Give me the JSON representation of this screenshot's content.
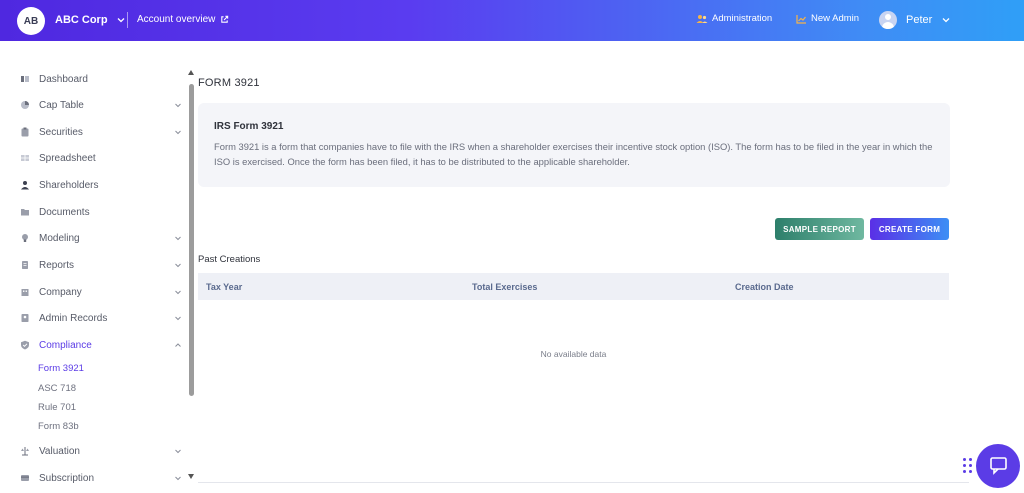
{
  "topbar": {
    "avatar_initials": "AB",
    "company_name": "ABC Corp",
    "account_link": "Account overview",
    "administration": "Administration",
    "new_admin": "New Admin",
    "user_name": "Peter"
  },
  "sidebar": {
    "items": [
      {
        "label": "Dashboard",
        "icon": "dashboard-icon",
        "has_arrow": false
      },
      {
        "label": "Cap Table",
        "icon": "pie-chart-icon",
        "has_arrow": true
      },
      {
        "label": "Securities",
        "icon": "clipboard-icon",
        "has_arrow": true
      },
      {
        "label": "Spreadsheet",
        "icon": "grid-icon",
        "has_arrow": false
      },
      {
        "label": "Shareholders",
        "icon": "person-icon",
        "has_arrow": false
      },
      {
        "label": "Documents",
        "icon": "folder-icon",
        "has_arrow": false
      },
      {
        "label": "Modeling",
        "icon": "lightbulb-icon",
        "has_arrow": true
      },
      {
        "label": "Reports",
        "icon": "report-icon",
        "has_arrow": true
      },
      {
        "label": "Company",
        "icon": "building-icon",
        "has_arrow": true
      },
      {
        "label": "Admin Records",
        "icon": "records-icon",
        "has_arrow": true
      },
      {
        "label": "Compliance",
        "icon": "shield-check-icon",
        "has_arrow": true,
        "expanded": true
      },
      {
        "label": "Valuation",
        "icon": "scale-icon",
        "has_arrow": true
      },
      {
        "label": "Subscription",
        "icon": "subscription-icon",
        "has_arrow": true
      }
    ],
    "compliance_sub": [
      "Form 3921",
      "ASC 718",
      "Rule 701",
      "Form 83b"
    ]
  },
  "main": {
    "page_title": "FORM 3921",
    "info_heading": "IRS Form 3921",
    "info_text": "Form 3921 is a form that companies have to file with the IRS when a shareholder exercises their incentive stock option (ISO). The form has to be filed in the year in which the ISO is exercised. Once the form has been filed, it has to be distributed to the applicable shareholder.",
    "sample_report_label": "SAMPLE REPORT",
    "create_form_label": "CREATE FORM",
    "past_creations_label": "Past Creations",
    "columns": [
      "Tax Year",
      "Total Exercises",
      "Creation Date"
    ],
    "empty_text": "No available data"
  },
  "colors": {
    "accent": "#5b3ce6",
    "sample_button": "#2d7f6b",
    "header_gradient_start": "#4f28e0",
    "header_gradient_end": "#2f9ff7"
  }
}
